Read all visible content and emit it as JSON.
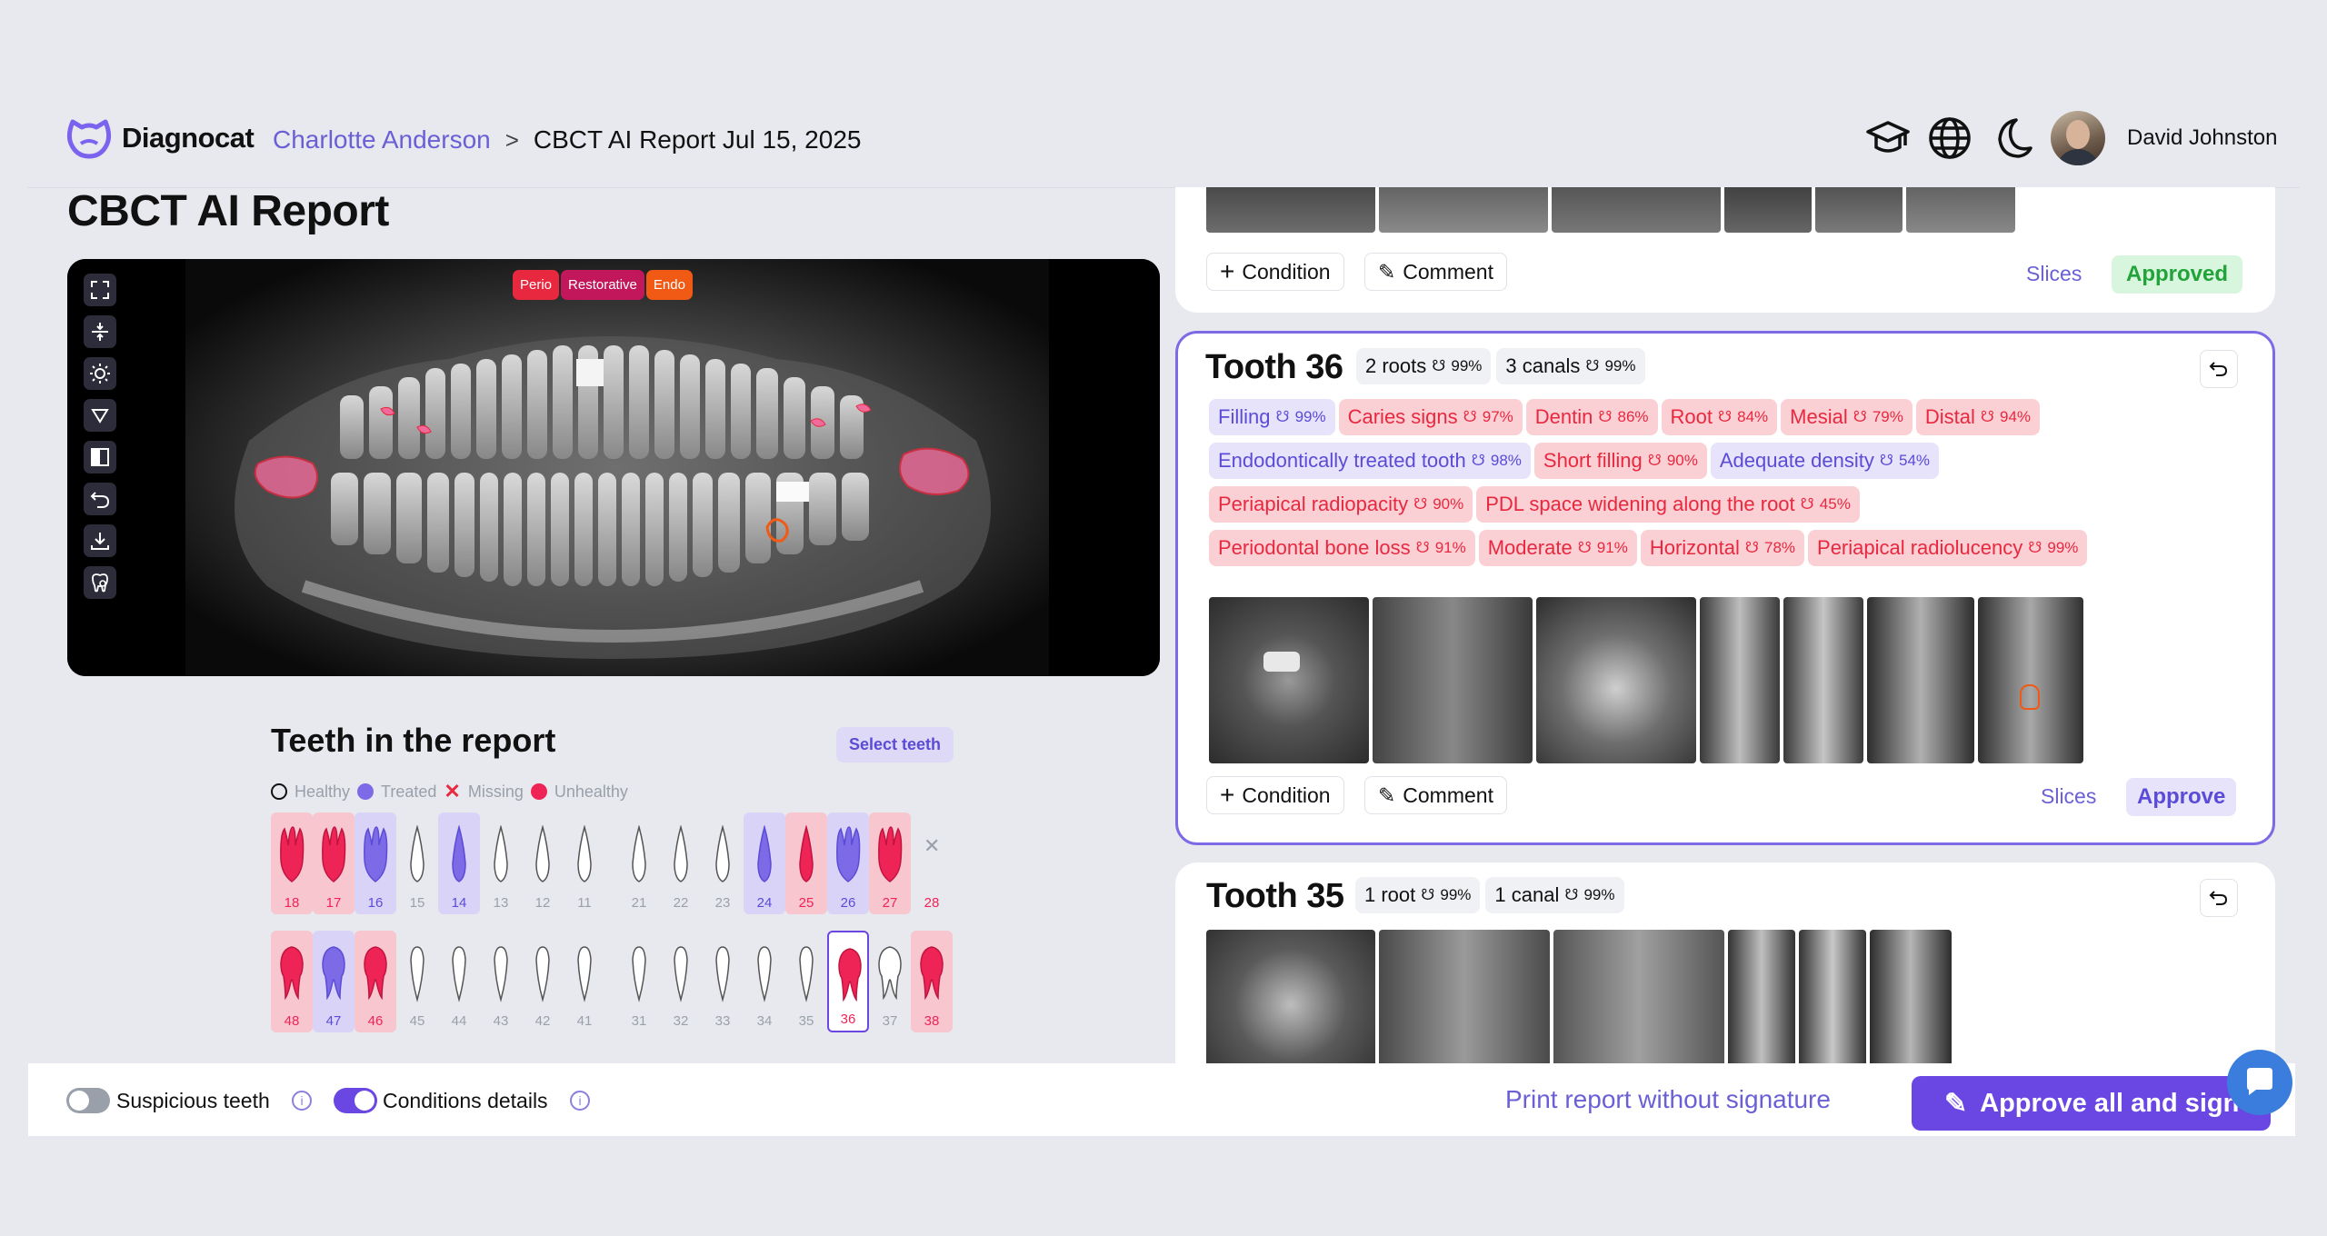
{
  "app": {
    "name": "Diagnocat",
    "brand_color": "#6b5fd6"
  },
  "breadcrumb": {
    "patient": "Charlotte Anderson",
    "separator": ">",
    "current": "CBCT AI Report Jul 15, 2025"
  },
  "header": {
    "user_name": "David Johnston",
    "icons": [
      "graduation-cap-icon",
      "globe-icon",
      "moon-icon"
    ]
  },
  "page": {
    "title": "CBCT AI Report"
  },
  "xray": {
    "tags": [
      {
        "label": "Perio",
        "color": "#e8283f"
      },
      {
        "label": "Restorative",
        "color": "#c2185b"
      },
      {
        "label": "Endo",
        "color": "#f05a14"
      }
    ],
    "tools": [
      "expand-icon",
      "split-vertical-icon",
      "brightness-icon",
      "triangle-down-icon",
      "contrast-icon",
      "undo-icon",
      "download-icon",
      "tooth-search-icon"
    ]
  },
  "teeth_panel": {
    "title": "Teeth in the report",
    "select_button": "Select teeth",
    "legend": {
      "healthy": "Healthy",
      "treated": "Treated",
      "missing": "Missing",
      "unhealthy": "Unhealthy"
    },
    "upper": [
      {
        "num": "18",
        "status": "unhealthy"
      },
      {
        "num": "17",
        "status": "unhealthy"
      },
      {
        "num": "16",
        "status": "treated"
      },
      {
        "num": "15",
        "status": "healthy"
      },
      {
        "num": "14",
        "status": "treated"
      },
      {
        "num": "13",
        "status": "healthy"
      },
      {
        "num": "12",
        "status": "healthy"
      },
      {
        "num": "11",
        "status": "healthy"
      },
      {
        "num": "21",
        "status": "healthy"
      },
      {
        "num": "22",
        "status": "healthy"
      },
      {
        "num": "23",
        "status": "healthy"
      },
      {
        "num": "24",
        "status": "treated"
      },
      {
        "num": "25",
        "status": "unhealthy"
      },
      {
        "num": "26",
        "status": "treated"
      },
      {
        "num": "27",
        "status": "unhealthy"
      },
      {
        "num": "28",
        "status": "missing"
      }
    ],
    "lower": [
      {
        "num": "48",
        "status": "unhealthy"
      },
      {
        "num": "47",
        "status": "treated"
      },
      {
        "num": "46",
        "status": "unhealthy"
      },
      {
        "num": "45",
        "status": "healthy"
      },
      {
        "num": "44",
        "status": "healthy"
      },
      {
        "num": "43",
        "status": "healthy"
      },
      {
        "num": "42",
        "status": "healthy"
      },
      {
        "num": "41",
        "status": "healthy"
      },
      {
        "num": "31",
        "status": "healthy"
      },
      {
        "num": "32",
        "status": "healthy"
      },
      {
        "num": "33",
        "status": "healthy"
      },
      {
        "num": "34",
        "status": "healthy"
      },
      {
        "num": "35",
        "status": "healthy"
      },
      {
        "num": "36",
        "status": "unhealthy-selected"
      },
      {
        "num": "37",
        "status": "healthy"
      },
      {
        "num": "38",
        "status": "unhealthy"
      }
    ]
  },
  "bottom": {
    "suspicious_label": "Suspicious teeth",
    "suspicious_on": false,
    "conditions_label": "Conditions details",
    "conditions_on": true,
    "print_label": "Print report without signature",
    "approve_all_label": "Approve all and sign"
  },
  "cards": {
    "prev": {
      "condition": "Condition",
      "comment": "Comment",
      "slices": "Slices",
      "status": "Approved"
    },
    "tooth36": {
      "title": "Tooth 36",
      "meta": [
        {
          "label": "2 roots",
          "pct": "99%"
        },
        {
          "label": "3 canals",
          "pct": "99%"
        }
      ],
      "rows": [
        [
          {
            "label": "Filling",
            "pct": "99%",
            "kind": "purple"
          },
          {
            "label": "Caries signs",
            "pct": "97%",
            "kind": "red"
          },
          {
            "label": "Dentin",
            "pct": "86%",
            "kind": "red"
          },
          {
            "label": "Root",
            "pct": "84%",
            "kind": "red"
          },
          {
            "label": "Mesial",
            "pct": "79%",
            "kind": "red"
          },
          {
            "label": "Distal",
            "pct": "94%",
            "kind": "red"
          }
        ],
        [
          {
            "label": "Endodontically treated tooth",
            "pct": "98%",
            "kind": "purple"
          },
          {
            "label": "Short filling",
            "pct": "90%",
            "kind": "red"
          },
          {
            "label": "Adequate density",
            "pct": "54%",
            "kind": "purple"
          }
        ],
        [
          {
            "label": "Periapical radiopacity",
            "pct": "90%",
            "kind": "red"
          },
          {
            "label": "PDL space widening along the root",
            "pct": "45%",
            "kind": "red"
          }
        ],
        [
          {
            "label": "Periodontal bone loss",
            "pct": "91%",
            "kind": "red"
          },
          {
            "label": "Moderate",
            "pct": "91%",
            "kind": "red"
          },
          {
            "label": "Horizontal",
            "pct": "78%",
            "kind": "red"
          },
          {
            "label": "Periapical radiolucency",
            "pct": "99%",
            "kind": "red"
          }
        ]
      ],
      "condition": "Condition",
      "comment": "Comment",
      "slices": "Slices",
      "approve": "Approve"
    },
    "tooth35": {
      "title": "Tooth 35",
      "meta": [
        {
          "label": "1 root",
          "pct": "99%"
        },
        {
          "label": "1 canal",
          "pct": "99%"
        }
      ]
    }
  }
}
